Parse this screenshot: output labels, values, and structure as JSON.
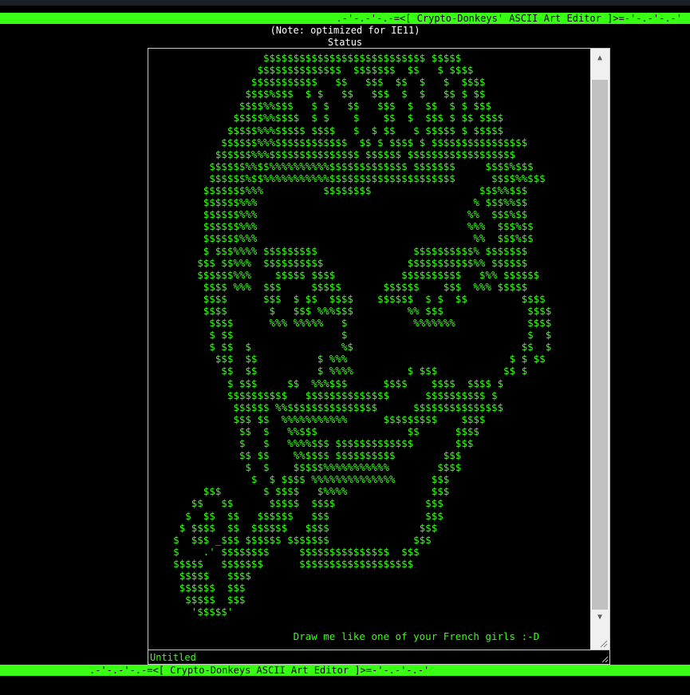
{
  "header": {
    "banner": ".-'-.-'-.-=<[ Crypto-Donkeys' ASCII Art Editor ]>=-'-.-'-.-'",
    "note": "(Note: optimized for IE11)",
    "status_label": "Status"
  },
  "editor": {
    "art_lines": [
      "                   $$$$$$$$$$$$$$$$$$$$$$$$$$$ $$$$$",
      "                  $$$$$$$$$$$$$$  $$$$$$$  $$   $ $$$$",
      "                 $$$$$$$$$$$   $$   $$$  $$  $   $  $$$$",
      "                $$$$%$$$  $ $   $$   $$$  $  $   $$ $ $$",
      "               $$$$%%$$$   $ $   $$   $$$  $  $$  $ $ $$$",
      "              $$$$$%%$$$$  $ $    $    $$  $  $$$ $ $$ $$$$",
      "             $$$$$%%%$$$$$ $$$$   $  $ $$   $ $$$$$ $ $$$$$",
      "            $$$$$$%%%$$$$$$$$$$$$  $$ $ $$$$ $ $$$$$$$$$$$$$$$$",
      "           $$$$$$%%%$$$$$$$$$$$$$$$ $$$$$$ $$$$$$$$$$$$$$$$$$",
      "          $$$$$$%%$$%%%%%%%%%%$$$$$$$$$$$$$ $$$$$$$     $$$$%$$$",
      "          $$$$$$%$$%%%%%%%%%%%$$$$$$$$$$$$$$$$$$$$$      $$$$%%$$$",
      "         $$$$$$$%%%          $$$$$$$$                  $$$%%$$$",
      "         $$$$$$%%%                                    % $$$%%$$",
      "         $$$$$$%%%                                   %%  $$$%$$",
      "         $$$$$$%%%                                   %%%  $$$%$$",
      "         $$$$$$%%%                                    %%  $$$%$$",
      "         $ $$$%%%% $$$$$$$$$                $$$$$$$$$$% $$$$$$$",
      "        $$$ $$%%%  $$$$$$$$$$              $$$$$$$$$$$%% $$$$$$",
      "        $$$$$$%%%    $$$$$ $$$$           $$$$$$$$$$   $%% $$$$$$",
      "         $$$$ %%%  $$$     $$$$$       $$$$$$    $$$  %%% $$$$$",
      "         $$$$      $$$  $ $$  $$$$    $$$$$$  $ $  $$         $$$$",
      "         $$$$       $   $$$ %%%$$$         %% $$$              $$$$",
      "          $$$$      %%% %%%%%   $           %%%%%%%            $$$$",
      "          $ $$                  $                              $  $",
      "          $ $$  $               %$                            $$  $",
      "           $$$  $$          $ %%%                           $ $ $$",
      "            $$  $$          $ %%%%         $ $$$           $$ $",
      "             $ $$$     $$  %%%$$$      $$$$    $$$$  $$$$ $",
      "             $$$$$$$$$$   $$$$$$$$$$$$$$      $$$$$$$$$$ $",
      "              $$$$$$ %%$$$$$$$$$$$$$$$      $$$$$$$$$$$$$$$",
      "              $$$ $$  %%%%%%%%%%%      $$$$$$$$$    $$$$",
      "               $$  $   %%$$$               $$      $$$$",
      "               $   $   %%%%$$$ $$$$$$$$$$$$$       $$$",
      "               $$ $$    %%$$$$ $$$$$$$$$$        $$$",
      "                $  $    $$$$$%%%%%%%%%%%        $$$$",
      "                 $  $ $$$$ %%%%%%%%%%%%%%      $$$",
      "         $$$       $ $$$$   $%%%%              $$$",
      "       $$   $$      $$$$$  $$$$               $$$",
      "      $  $$  $$   $$$$$$   $$$                $$$",
      "     $ $$$$  $$  $$$$$$   $$$$               $$$",
      "    $  $$$ _$$$ $$$$$$ $$$$$$$              $$$",
      "    $    .' $$$$$$$$     $$$$$$$$$$$$$$$  $$$",
      "    $$$$$   $$$$$$$      $$$$$$$$$$$$$$$$$$$",
      "     $$$$$   $$$$",
      "     $$$$$$  $$$",
      "      $$$$$  $$$",
      "       '$$$$$'",
      "",
      "                        Draw me like one of your French girls :-D"
    ],
    "filename": "Untitled"
  },
  "footer": {
    "banner": ".-'-.-'-.-=<[ Crypto-Donkeys ASCII Art Editor ]>=-'-.-'-.-'"
  },
  "colors": {
    "accent": "#39ff14",
    "background": "#000000"
  }
}
